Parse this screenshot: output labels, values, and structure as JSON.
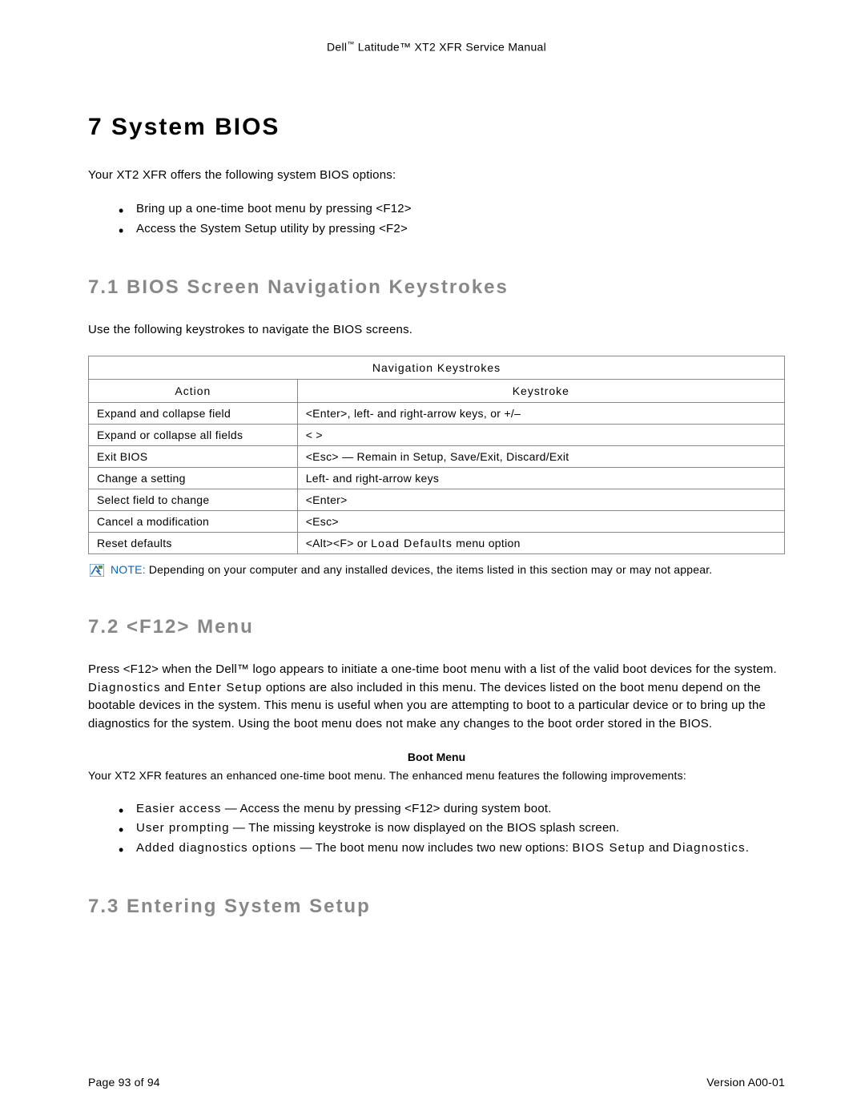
{
  "header": {
    "prefix": "Dell",
    "tm": "™",
    "rest": " Latitude™ XT2 XFR Service Manual"
  },
  "h1": "7 System BIOS",
  "intro": "Your XT2 XFR offers the following system BIOS options:",
  "intro_bullets": [
    "Bring up a one-time boot menu by pressing <F12>",
    "Access the System Setup utility by pressing <F2>"
  ],
  "section_71": {
    "heading": "7.1 BIOS Screen Navigation Keystrokes",
    "intro": "Use the following keystrokes to navigate the BIOS screens.",
    "table": {
      "title": "Navigation Keystrokes",
      "col1": "Action",
      "col2": "Keystroke",
      "rows": [
        {
          "action": "Expand and collapse field",
          "keystroke": "<Enter>, left- and right-arrow keys, or +/–"
        },
        {
          "action": "Expand or collapse all fields",
          "keystroke": "< >"
        },
        {
          "action": "Exit BIOS",
          "keystroke": "<Esc> — Remain in Setup, Save/Exit, Discard/Exit"
        },
        {
          "action": "Change a setting",
          "keystroke": "Left- and right-arrow keys"
        },
        {
          "action": "Select field to change",
          "keystroke": "<Enter>"
        },
        {
          "action": "Cancel a modification",
          "keystroke": "<Esc>"
        },
        {
          "action": "Reset defaults",
          "keystroke_pre": "<Alt><F> or ",
          "keystroke_bold": "Load Defaults",
          "keystroke_post": " menu option"
        }
      ]
    },
    "note_label": "NOTE:",
    "note_text": " Depending on your computer and any installed devices, the items listed in this section may or may not appear."
  },
  "section_72": {
    "heading": "7.2 <F12> Menu",
    "para_pre": "Press <F12> when the Dell™ logo appears to initiate a one-time boot menu with a list of the valid boot devices for the system. ",
    "para_bold1": "Diagnostics",
    "para_mid": " and ",
    "para_bold2": "Enter Setup",
    "para_post": " options are also included in this menu. The devices listed on the boot menu depend on the bootable devices in the system. This menu is useful when you are attempting to boot to a particular device or to bring up the diagnostics for the system. Using the boot menu does not make any changes to the boot order stored in the BIOS.",
    "boot_menu_title": "Boot Menu",
    "boot_menu_intro": "Your XT2 XFR features an enhanced one-time boot menu. The enhanced menu features the following improvements:",
    "boot_bullets": [
      {
        "lead": "Easier access",
        "rest": " — Access the menu by pressing <F12> during system boot."
      },
      {
        "lead": "User prompting",
        "rest": " — The missing keystroke is now displayed on the BIOS splash screen."
      },
      {
        "lead": "Added diagnostics options",
        "rest_pre": " — The boot menu now includes two new options: ",
        "rest_bold1": "BIOS Setup",
        "rest_mid": " and ",
        "rest_bold2": "Diagnostics",
        "rest_post": "."
      }
    ]
  },
  "section_73": {
    "heading": "7.3 Entering System Setup"
  },
  "footer": {
    "left": "Page 93 of 94",
    "right": "Version A00-01"
  }
}
